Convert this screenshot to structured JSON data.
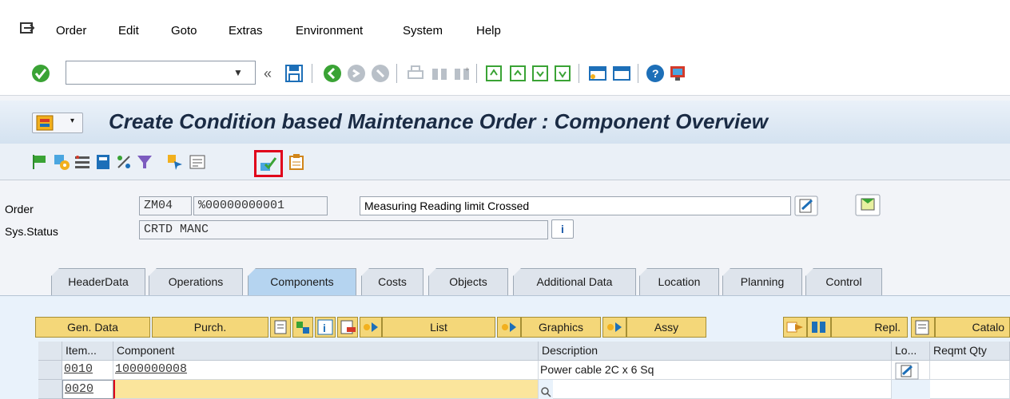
{
  "menu": {
    "items": [
      {
        "label": "Order"
      },
      {
        "label": "Edit"
      },
      {
        "label": "Goto"
      },
      {
        "label": "Extras"
      },
      {
        "label": "Environment"
      },
      {
        "label": "System"
      },
      {
        "label": "Help"
      }
    ]
  },
  "toolbar": {
    "command_value": "",
    "collapse_glyph": "«"
  },
  "title": "Create Condition based Maintenance Order : Component Overview",
  "header": {
    "order_label": "Order",
    "order_type": "ZM04",
    "order_number": "%00000000001",
    "order_description": "Measuring Reading limit Crossed",
    "status_label": "Sys.Status",
    "status_value": "CRTD MANC",
    "info_glyph": "i"
  },
  "tabs": [
    {
      "label": "HeaderData",
      "active": false
    },
    {
      "label": "Operations",
      "active": false
    },
    {
      "label": "Components",
      "active": true
    },
    {
      "label": "Costs",
      "active": false
    },
    {
      "label": "Objects",
      "active": false
    },
    {
      "label": "Additional Data",
      "active": false
    },
    {
      "label": "Location",
      "active": false
    },
    {
      "label": "Planning",
      "active": false
    },
    {
      "label": "Control",
      "active": false
    }
  ],
  "grid_toolbar": {
    "gen_data": "Gen. Data",
    "purch": "Purch.",
    "list": "List",
    "graphics": "Graphics",
    "assy": "Assy",
    "repl": "Repl.",
    "catalog": "Catalo"
  },
  "grid": {
    "columns": [
      "Item...",
      "Component",
      "Description",
      "Lo...",
      "Reqmt Qty"
    ],
    "rows": [
      {
        "item": "0010",
        "component": "1000000008",
        "description": "Power cable 2C x 6 Sq"
      },
      {
        "item": "0020",
        "component": "",
        "description": ""
      }
    ]
  },
  "colors": {
    "accent": "#e0001a",
    "title_bg": "#d4e2f0",
    "grid_button": "#f4d779",
    "tab_active": "#b5d4f0"
  }
}
